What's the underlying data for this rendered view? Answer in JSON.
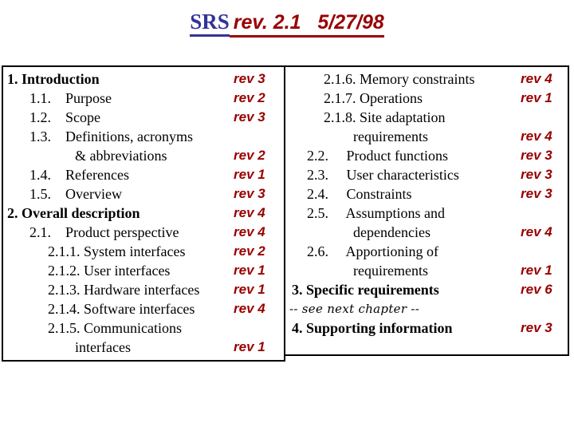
{
  "title": {
    "doc_label": "SRS",
    "revision_date": "rev. 2.1   5/27/98",
    "blue_hex": "#333399",
    "red_hex": "#990000"
  },
  "columns": {
    "left": {
      "rows": [
        {
          "label": "1. Introduction",
          "level": 1,
          "rev": "rev 3"
        },
        {
          "label": "1.1.    Purpose",
          "level": 2,
          "rev": "rev 2"
        },
        {
          "label": "1.2.    Scope",
          "level": 2,
          "rev": "rev 3"
        },
        {
          "label": "1.3.    Definitions, acronyms",
          "level": 2,
          "rev": ""
        },
        {
          "label": "& abbreviations",
          "level": 4,
          "rev": "rev 2"
        },
        {
          "label": "1.4.    References",
          "level": 2,
          "rev": "rev 1"
        },
        {
          "label": "1.5.    Overview",
          "level": 2,
          "rev": "rev 3"
        },
        {
          "label": "2. Overall description",
          "level": 1,
          "rev": "rev 4"
        },
        {
          "label": "2.1.    Product perspective",
          "level": 2,
          "rev": "rev 4"
        },
        {
          "label": "2.1.1. System interfaces",
          "level": 3,
          "rev": "rev 2"
        },
        {
          "label": "2.1.2. User interfaces",
          "level": 3,
          "rev": "rev 1"
        },
        {
          "label": "2.1.3. Hardware interfaces",
          "level": 3,
          "rev": "rev 1"
        },
        {
          "label": "2.1.4. Software interfaces",
          "level": 3,
          "rev": "rev 4"
        },
        {
          "label": "2.1.5. Communications",
          "level": 3,
          "rev": ""
        },
        {
          "label": "interfaces",
          "level": 4,
          "rev": "rev 1"
        }
      ]
    },
    "right": {
      "rows": [
        {
          "label": "2.1.6. Memory constraints",
          "level": 3,
          "rev": "rev 4"
        },
        {
          "label": "2.1.7. Operations",
          "level": 3,
          "rev": "rev 1"
        },
        {
          "label": "2.1.8. Site adaptation",
          "level": 3,
          "rev": ""
        },
        {
          "label": "requirements",
          "level": 4,
          "rev": "rev 4"
        },
        {
          "label": "2.2.     Product functions",
          "level": 2,
          "rev": "rev 3"
        },
        {
          "label": "2.3.     User characteristics",
          "level": 2,
          "rev": "rev 3"
        },
        {
          "label": "2.4.     Constraints",
          "level": 2,
          "rev": "rev 3"
        },
        {
          "label": "2.5.     Assumptions and",
          "level": 2,
          "rev": ""
        },
        {
          "label": "dependencies",
          "level": 4,
          "rev": "rev 4"
        },
        {
          "label": "2.6.     Apportioning of",
          "level": 2,
          "rev": ""
        },
        {
          "label": "requirements",
          "level": 4,
          "rev": "rev 1"
        },
        {
          "label": "3. Specific requirements",
          "level": 1,
          "rev": "rev 6"
        },
        {
          "label": "-- see next chapter --",
          "level": 0,
          "rev": ""
        },
        {
          "label": "4. Supporting information",
          "level": 1,
          "rev": "rev 3"
        }
      ]
    }
  }
}
